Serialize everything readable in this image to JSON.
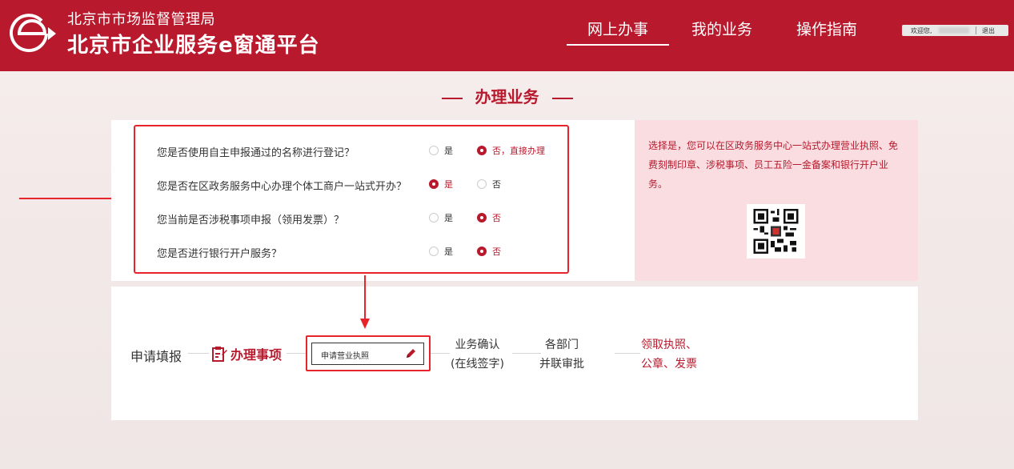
{
  "header": {
    "org_name": "北京市市场监督管理局",
    "platform_name": "北京市企业服务e窗通平台",
    "nav": [
      {
        "label": "网上办事",
        "active": true
      },
      {
        "label": "我的业务",
        "active": false
      },
      {
        "label": "操作指南",
        "active": false
      }
    ],
    "user": {
      "welcome": "欢迎您,",
      "logout": "退出"
    }
  },
  "section_title": "办理业务",
  "questions": [
    {
      "text": "您是否使用自主申报通过的名称进行登记？",
      "yes_label": "是",
      "no_label": "否，直接办理",
      "selected": "no"
    },
    {
      "text": "您是否在区政务服务中心办理个体工商户一站式开办？",
      "yes_label": "是",
      "no_label": "否",
      "selected": "yes"
    },
    {
      "text": "您当前是否涉税事项申报（领用发票）？",
      "yes_label": "是",
      "no_label": "否",
      "selected": "no"
    },
    {
      "text": "您是否进行银行开户服务？",
      "yes_label": "是",
      "no_label": "否",
      "selected": "no"
    }
  ],
  "info": {
    "text": "选择是，您可以在区政务服务中心一站式办理营业执照、免费刻制印章、涉税事项、员工五险一金备案和银行开户业务。"
  },
  "process": {
    "start": "申请填报",
    "active": "办理事项",
    "apply_button": "申请营业执照",
    "step2_line1": "业务确认",
    "step2_line2": "(在线签字)",
    "step3_line1": "各部门",
    "step3_line2": "并联审批",
    "step4_line1": "领取执照、",
    "step4_line2": "公章、发票"
  },
  "colors": {
    "brand": "#b8192c",
    "highlight": "#e5252b",
    "info_bg": "#fadde1"
  }
}
